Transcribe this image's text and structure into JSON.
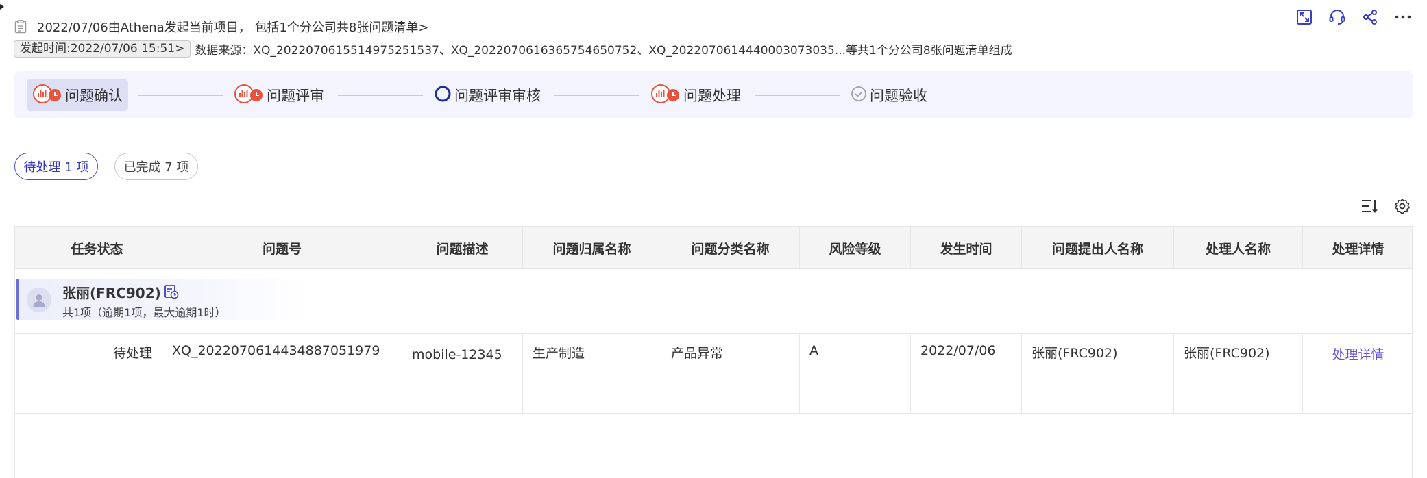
{
  "header": {
    "title": "2022/07/06由Athena发起当前项目， 包括1个分公司共8张问题清单>",
    "start_badge": "发起时间:2022/07/06 15:51>",
    "source": "数据来源：XQ_202207061551497525153​7、XQ_2022070616365754650752、XQ_202207061444000307303​5...等共1个分公司8张问题清单组成"
  },
  "top_actions": [
    {
      "icon": "expand-icon"
    },
    {
      "icon": "headset-icon"
    },
    {
      "icon": "share-icon"
    },
    {
      "icon": "more-icon"
    }
  ],
  "steps": [
    {
      "label": "问题确认",
      "icon": "pending-clock-icon",
      "active": true
    },
    {
      "label": "问题评审",
      "icon": "pending-clock-icon",
      "active": false
    },
    {
      "label": "问题评审审核",
      "icon": "circle-outline-icon",
      "active": false
    },
    {
      "label": "问题处理",
      "icon": "pending-clock-icon",
      "active": false
    },
    {
      "label": "问题验收",
      "icon": "check-circle-icon",
      "active": false
    }
  ],
  "filters": {
    "pending": "待处理 1 项",
    "done": "已完成 7 项"
  },
  "table": {
    "columns": [
      "任务状态",
      "问题号",
      "问题描述",
      "问题归属名称",
      "问题分类名称",
      "风险等级",
      "发生时间",
      "问题提出人名称",
      "处理人名称",
      "处理详情"
    ],
    "group": {
      "name": "张丽(FRC902)",
      "summary": "共1项（逾期1项，最大逾期1时）"
    },
    "rows": [
      {
        "status": "待处理",
        "issue_no": "XQ_2022070614434887051979",
        "description": "mobile-12345",
        "belong": "生产制造",
        "category": "产品异常",
        "risk": "A",
        "time": "2022/07/06",
        "proposer": "张丽(FRC902)",
        "handler": "张丽(FRC902)",
        "detail": "处理详情"
      }
    ]
  },
  "colors": {
    "accent": "#4a4fd1",
    "link": "#6a4fd8",
    "warning": "#e8533f",
    "steps_bg": "#f3f4fd"
  }
}
